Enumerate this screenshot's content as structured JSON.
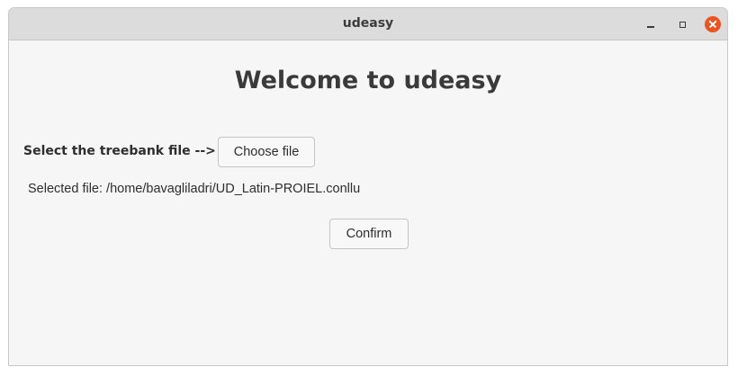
{
  "window": {
    "title": "udeasy"
  },
  "main": {
    "heading": "Welcome to udeasy",
    "select_label": "Select the treebank file -->",
    "choose_button": "Choose file",
    "selected_file": "Selected file: /home/bavagliladri/UD_Latin-PROIEL.conllu",
    "confirm_button": "Confirm"
  },
  "colors": {
    "close_button": "#e95420",
    "titlebar": "#dcdcdc",
    "background": "#f6f6f6"
  },
  "icons": {
    "minimize": "minimize-icon",
    "maximize": "maximize-icon",
    "close": "close-icon"
  }
}
